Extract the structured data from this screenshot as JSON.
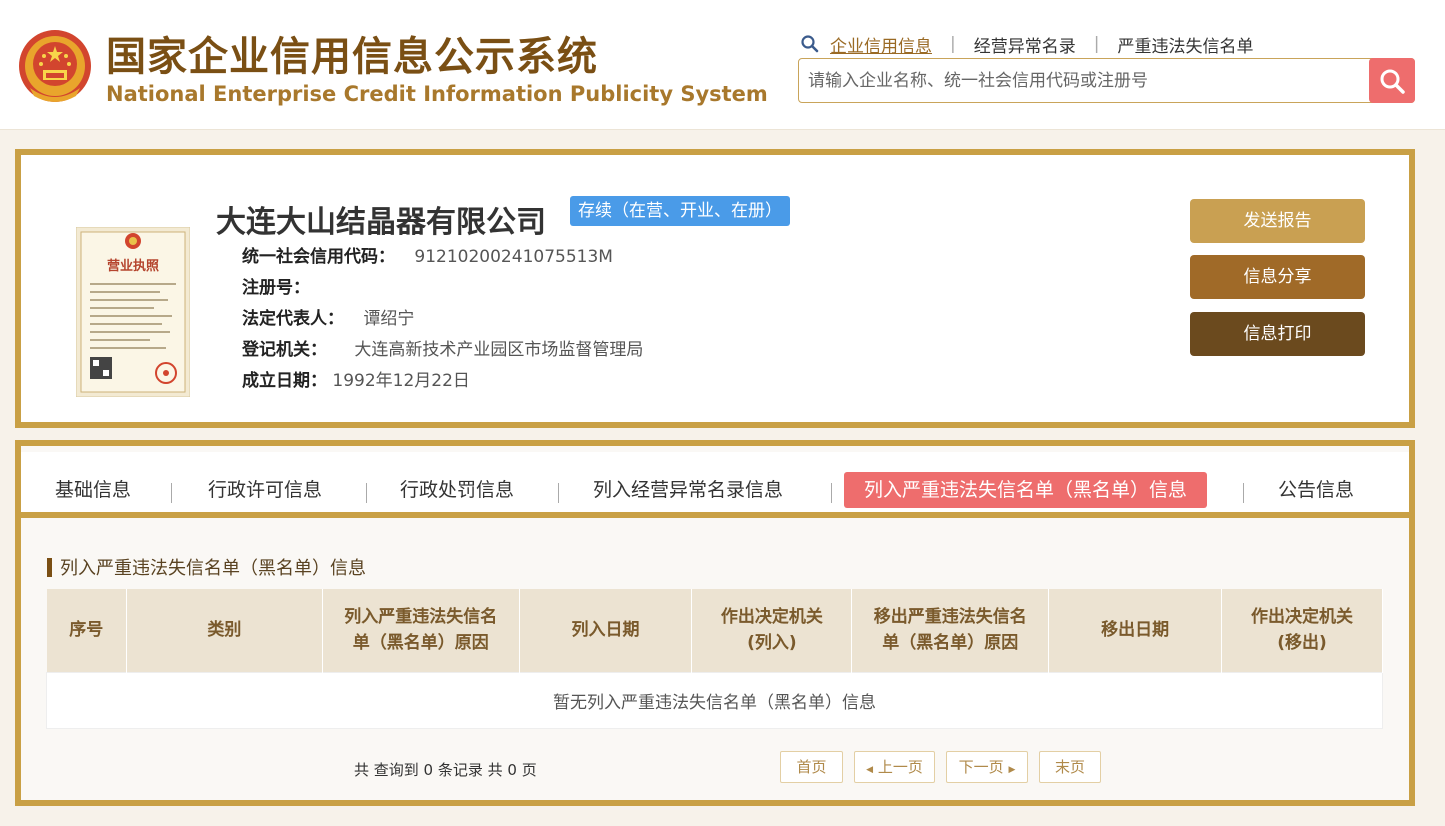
{
  "header": {
    "title_cn": "国家企业信用信息公示系统",
    "title_en": "National Enterprise Credit Information Publicity System",
    "nav": [
      {
        "label": "企业信用信息",
        "active": true
      },
      {
        "label": "经营异常名录",
        "active": false
      },
      {
        "label": "严重违法失信名单",
        "active": false
      }
    ],
    "search": {
      "placeholder": "请输入企业名称、统一社会信用代码或注册号",
      "value": ""
    },
    "icons": {
      "nav": "magnifier-icon",
      "search": "search-icon"
    }
  },
  "company": {
    "name": "大连大山结晶器有限公司",
    "status": "存续（在营、开业、在册）",
    "license_image_text": "营业执照",
    "fields": {
      "credit_code": {
        "label": "统一社会信用代码：",
        "value": "91210200241075513M"
      },
      "reg_no": {
        "label": "注册号：",
        "value": ""
      },
      "legal_rep": {
        "label": "法定代表人：",
        "value": "谭绍宁"
      },
      "reg_authority": {
        "label": "登记机关：",
        "value": "大连高新技术产业园区市场监督管理局"
      },
      "est_date": {
        "label": "成立日期：",
        "value": "1992年12月22日"
      }
    },
    "actions": {
      "send": "发送报告",
      "share": "信息分享",
      "print": "信息打印"
    }
  },
  "tabs": [
    {
      "label": "基础信息",
      "active": false
    },
    {
      "label": "行政许可信息",
      "active": false
    },
    {
      "label": "行政处罚信息",
      "active": false
    },
    {
      "label": "列入经营异常名录信息",
      "active": false
    },
    {
      "label": "列入严重违法失信名单（黑名单）信息",
      "active": true
    },
    {
      "label": "公告信息",
      "active": false
    }
  ],
  "section": {
    "title": "列入严重违法失信名单（黑名单）信息",
    "columns": [
      [
        "序号",
        ""
      ],
      [
        "类别",
        ""
      ],
      [
        "列入严重违法失信名",
        "单（黑名单）原因"
      ],
      [
        "列入日期",
        ""
      ],
      [
        "作出决定机关",
        "(列入)"
      ],
      [
        "移出严重违法失信名",
        "单（黑名单）原因"
      ],
      [
        "移出日期",
        ""
      ],
      [
        "作出决定机关",
        "(移出)"
      ]
    ],
    "empty_text": "暂无列入严重违法失信名单（黑名单）信息"
  },
  "pager": {
    "summary": "共 查询到 0 条记录 共 0 页",
    "first": "首页",
    "prev": "上一页",
    "next": "下一页",
    "last": "末页"
  },
  "colors": {
    "brand_gold": "#c9a045",
    "brand_brown": "#7a4f14",
    "accent_red": "#ee6d6d",
    "status_blue": "#4a9be8"
  }
}
